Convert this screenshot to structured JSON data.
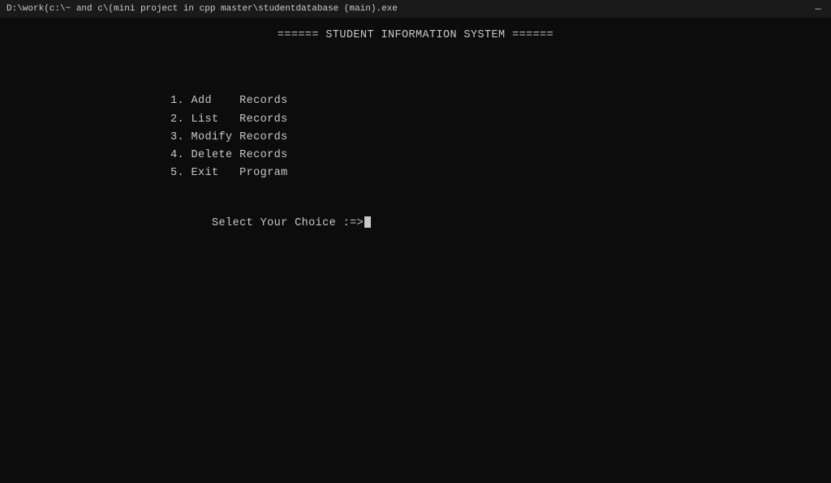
{
  "titleBar": {
    "text": "D:\\work(c:\\~ and c\\(mini project in cpp master\\studentdatabase (main).exe",
    "minimizeBtn": "—"
  },
  "terminal": {
    "header": "====== STUDENT INFORMATION SYSTEM ======",
    "menuItems": [
      "1. Add    Records",
      "2. List   Records",
      "3. Modify Records",
      "4. Delete Records",
      "5. Exit   Program"
    ],
    "prompt": "Select Your Choice :=>"
  }
}
